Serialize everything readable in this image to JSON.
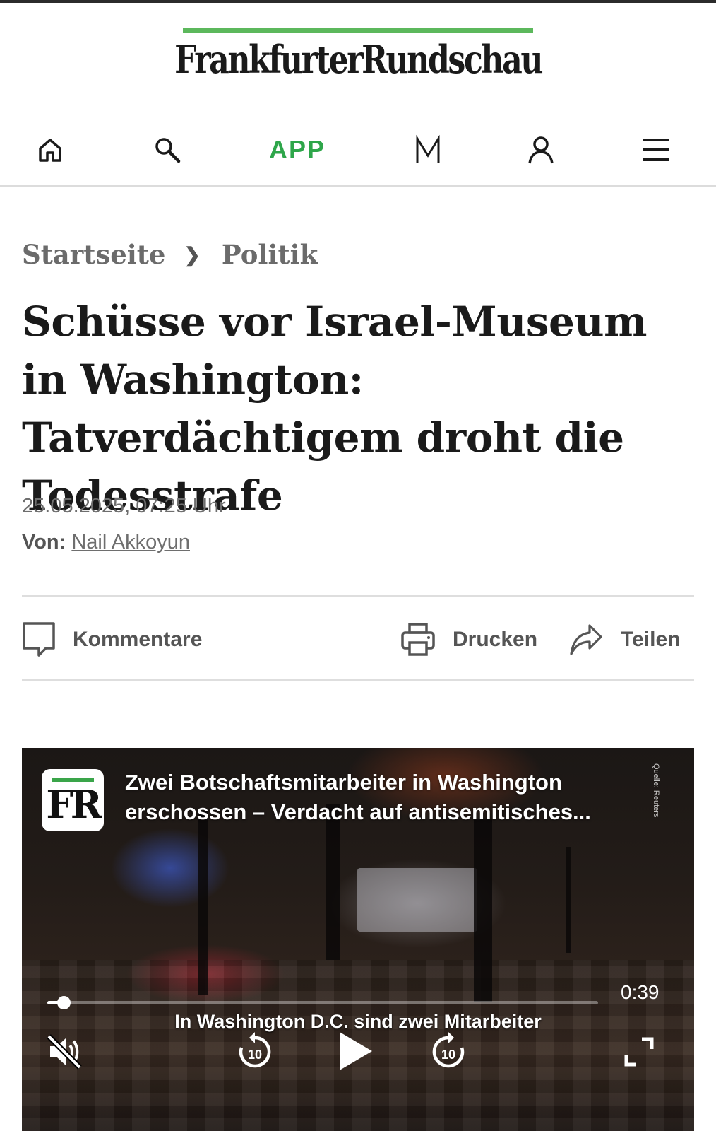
{
  "masthead": {
    "logo": "FrankfurterRundschau",
    "brand_color": "#5cb85c"
  },
  "nav": {
    "items": [
      {
        "name": "home",
        "icon": "home-icon"
      },
      {
        "name": "search",
        "icon": "search-icon"
      },
      {
        "name": "app",
        "label": "APP",
        "color": "#2ea64a"
      },
      {
        "name": "merkliste",
        "icon": "m-icon"
      },
      {
        "name": "account",
        "icon": "user-icon"
      },
      {
        "name": "menu",
        "icon": "hamburger-icon"
      }
    ]
  },
  "breadcrumb": {
    "items": [
      "Startseite",
      "Politik"
    ],
    "separator": "❯"
  },
  "article": {
    "headline": "Schüsse vor Israel-Museum in Washington: Tatverdächtigem droht die Todesstrafe",
    "date": "25.05.2025, 07:25 Uhr",
    "author_label": "Von:",
    "author_name": "Nail Akkoyun"
  },
  "actions": {
    "comments": "Kommentare",
    "print": "Drucken",
    "share": "Teilen"
  },
  "video": {
    "badge": "FR",
    "title_line1": "Zwei Botschaftsmitarbeiter in Washington",
    "title_line2": "erschossen – Verdacht auf antisemitisches...",
    "source": "Quelle: Reuters",
    "duration": "0:39",
    "progress_fraction": 0.03,
    "subtitle": "In Washington D.C. sind zwei Mitarbeiter",
    "muted": true,
    "skip_seconds": "10"
  }
}
